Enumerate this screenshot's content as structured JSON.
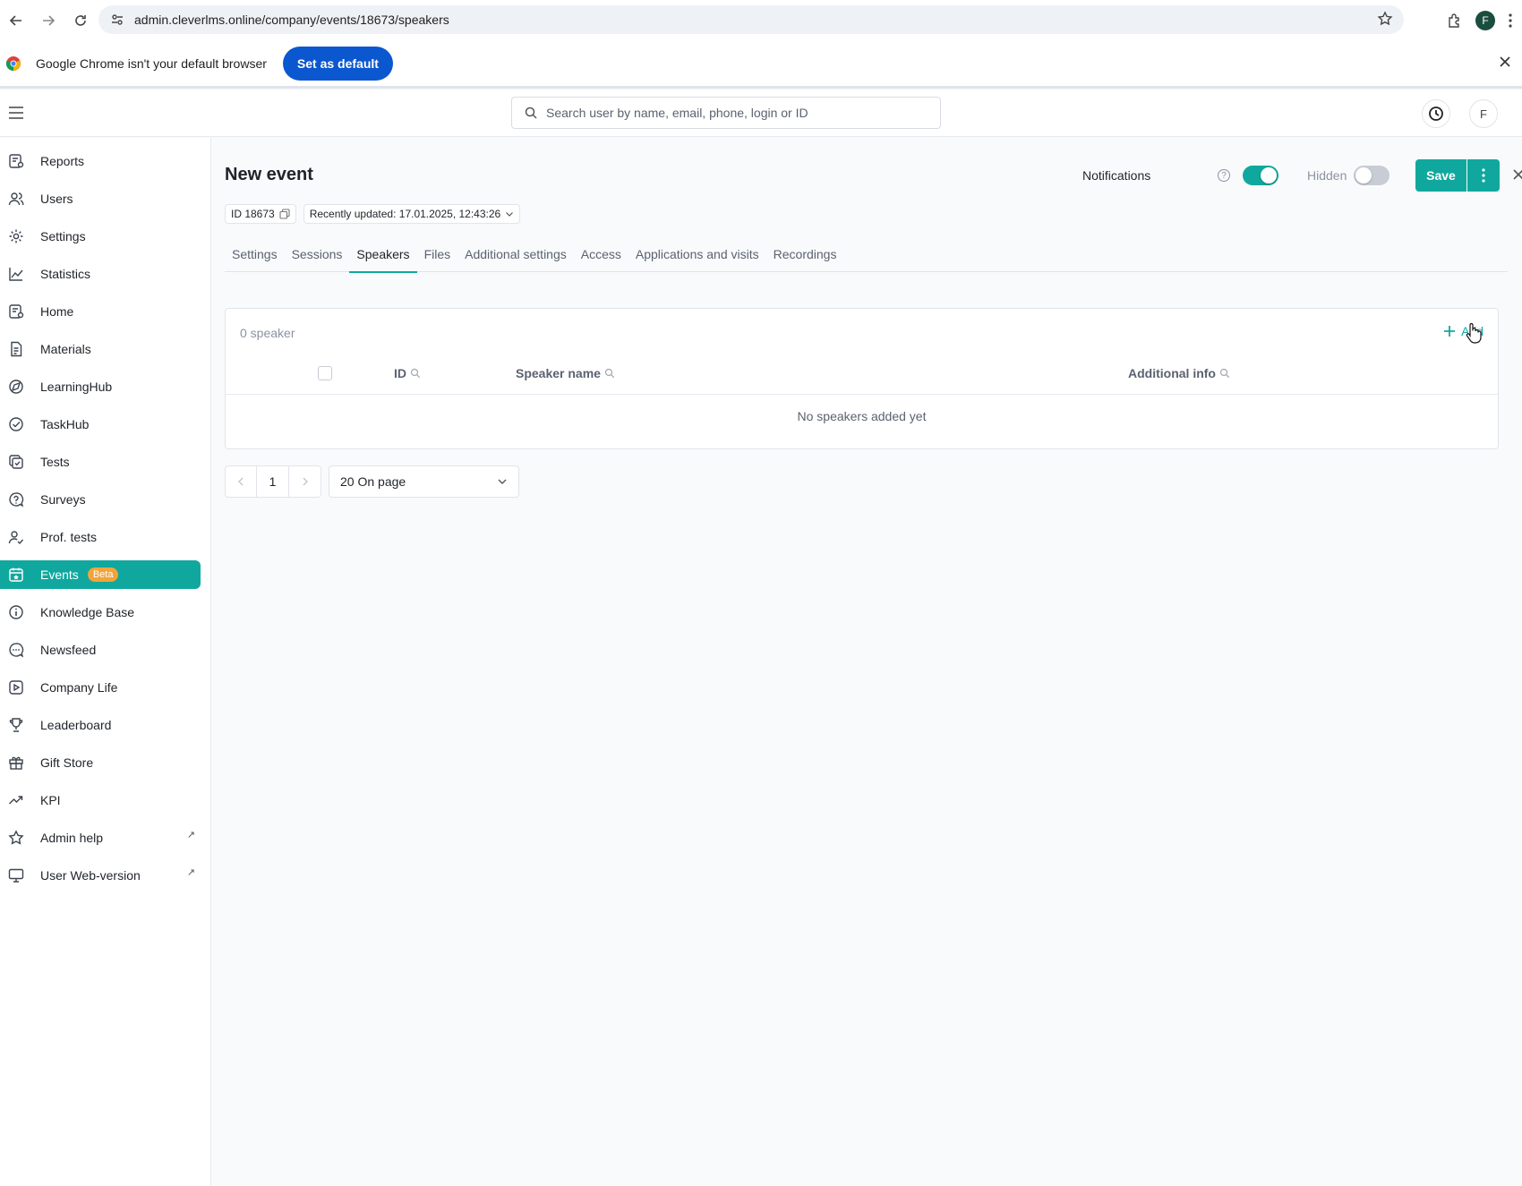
{
  "browser": {
    "url": "admin.cleverlms.online/company/events/18673/speakers",
    "profile_initial": "F",
    "infobar_message": "Google Chrome isn't your default browser",
    "set_default_label": "Set as default"
  },
  "header": {
    "search_placeholder": "Search user by name, email, phone, login or ID",
    "avatar_initial": "F"
  },
  "sidebar": {
    "items": [
      {
        "label": "Reports",
        "icon": "reports-icon"
      },
      {
        "label": "Users",
        "icon": "users-icon"
      },
      {
        "label": "Settings",
        "icon": "gear-icon"
      },
      {
        "label": "Statistics",
        "icon": "chart-icon"
      },
      {
        "label": "Home",
        "icon": "home-icon"
      },
      {
        "label": "Materials",
        "icon": "document-icon"
      },
      {
        "label": "LearningHub",
        "icon": "compass-icon"
      },
      {
        "label": "TaskHub",
        "icon": "check-circle-icon"
      },
      {
        "label": "Tests",
        "icon": "tests-icon"
      },
      {
        "label": "Surveys",
        "icon": "question-bubble-icon"
      },
      {
        "label": "Prof. tests",
        "icon": "user-check-icon"
      },
      {
        "label": "Events",
        "icon": "calendar-icon",
        "badge": "Beta",
        "active": true
      },
      {
        "label": "Knowledge Base",
        "icon": "info-icon"
      },
      {
        "label": "Newsfeed",
        "icon": "chat-icon"
      },
      {
        "label": "Company Life",
        "icon": "play-icon"
      },
      {
        "label": "Leaderboard",
        "icon": "trophy-icon"
      },
      {
        "label": "Gift Store",
        "icon": "gift-icon"
      },
      {
        "label": "KPI",
        "icon": "trend-icon"
      },
      {
        "label": "Admin help",
        "icon": "star-icon",
        "external": true
      },
      {
        "label": "User Web-version",
        "icon": "monitor-icon",
        "external": true
      }
    ]
  },
  "page": {
    "title": "New event",
    "id_label": "ID 18673",
    "updated_label": "Recently updated: 17.01.2025, 12:43:26",
    "notifications_label": "Notifications",
    "notifications_on": true,
    "hidden_label": "Hidden",
    "hidden_on": false,
    "save_label": "Save",
    "help_glyph": "?"
  },
  "tabs": [
    {
      "label": "Settings"
    },
    {
      "label": "Sessions"
    },
    {
      "label": "Speakers",
      "active": true
    },
    {
      "label": "Files"
    },
    {
      "label": "Additional settings"
    },
    {
      "label": "Access"
    },
    {
      "label": "Applications and visits"
    },
    {
      "label": "Recordings"
    }
  ],
  "speakers": {
    "count_label": "0 speaker",
    "add_label": "Add",
    "columns": {
      "id": "ID",
      "name": "Speaker name",
      "info": "Additional info"
    },
    "empty_text": "No speakers added yet"
  },
  "pagination": {
    "current_page": "1",
    "per_page": "20 On page"
  },
  "colors": {
    "accent": "#10a89e",
    "beta_badge": "#f2a33a",
    "chrome_button": "#0b57d0"
  }
}
